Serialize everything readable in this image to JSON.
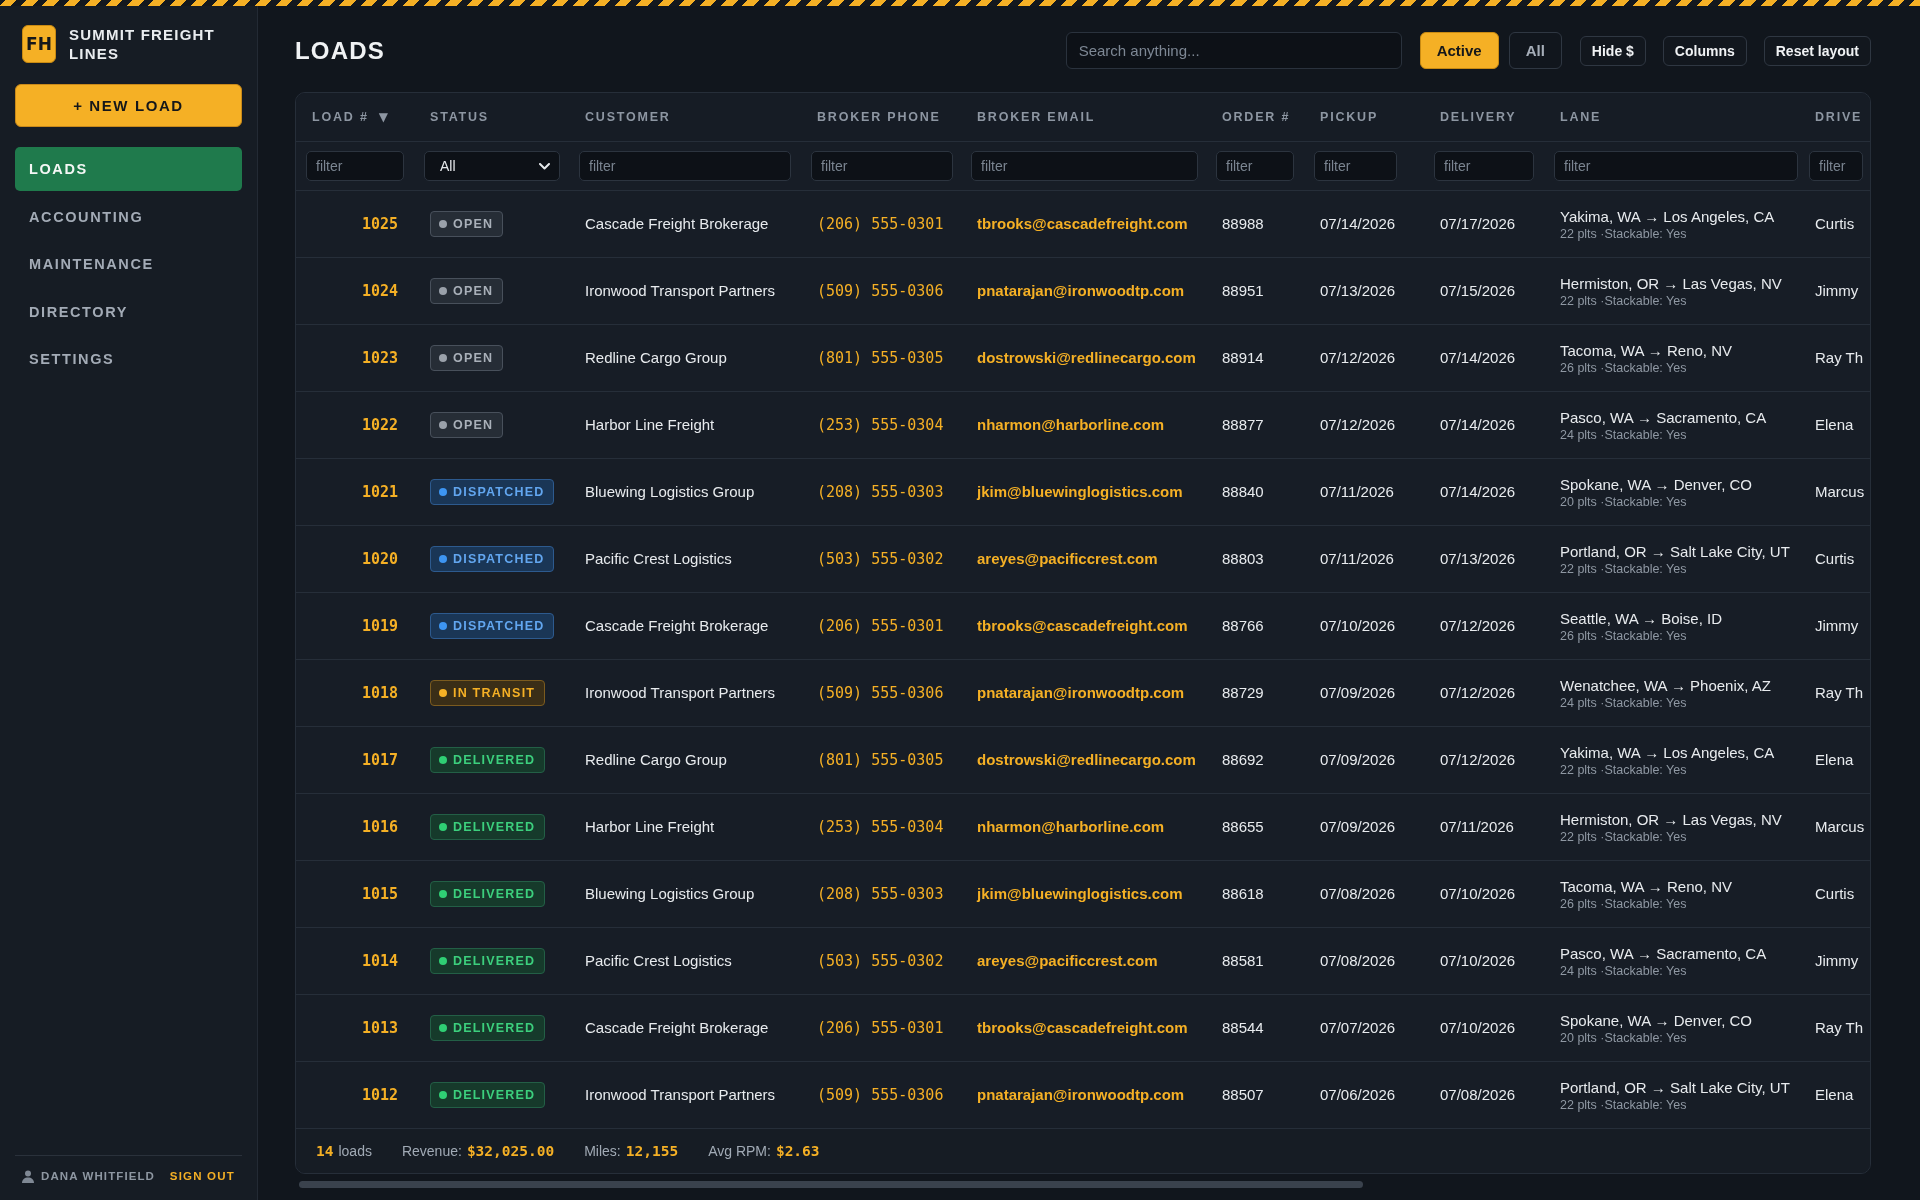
{
  "brand": {
    "badge": "FH",
    "name": "SUMMIT FREIGHT LINES"
  },
  "sidebar": {
    "new_button": "+ NEW LOAD",
    "items": [
      {
        "label": "LOADS",
        "selected": true
      },
      {
        "label": "ACCOUNTING",
        "selected": false
      },
      {
        "label": "MAINTENANCE",
        "selected": false
      },
      {
        "label": "DIRECTORY",
        "selected": false
      },
      {
        "label": "SETTINGS",
        "selected": false
      }
    ],
    "user": {
      "name": "DANA WHITFIELD",
      "sign_out": "SIGN OUT"
    }
  },
  "header": {
    "title": "LOADS",
    "search": {
      "placeholder": "Search anything..."
    },
    "view_filters": [
      {
        "label": "Active",
        "selected": true
      },
      {
        "label": "All",
        "selected": false
      }
    ],
    "buttons": [
      "Hide $",
      "Columns",
      "Reset layout"
    ]
  },
  "table": {
    "columns": [
      {
        "label": "LOAD #",
        "sort": "▼",
        "filter": {
          "kind": "text",
          "placeholder": "filter"
        }
      },
      {
        "label": "STATUS",
        "filter": {
          "kind": "select",
          "value": "All"
        }
      },
      {
        "label": "CUSTOMER",
        "filter": {
          "kind": "text",
          "placeholder": "filter"
        }
      },
      {
        "label": "BROKER PHONE",
        "filter": {
          "kind": "text",
          "placeholder": "filter"
        }
      },
      {
        "label": "BROKER EMAIL",
        "filter": {
          "kind": "text",
          "placeholder": "filter"
        }
      },
      {
        "label": "ORDER #",
        "filter": {
          "kind": "text",
          "placeholder": "filter"
        }
      },
      {
        "label": "PICKUP",
        "filter": {
          "kind": "text",
          "placeholder": "filter"
        }
      },
      {
        "label": "DELIVERY",
        "filter": {
          "kind": "text",
          "placeholder": "filter"
        }
      },
      {
        "label": "LANE",
        "filter": {
          "kind": "text",
          "placeholder": "filter"
        }
      },
      {
        "label": "DRIVE",
        "filter": {
          "kind": "text",
          "placeholder": "filter"
        }
      }
    ],
    "rows": [
      {
        "load": "1025",
        "status": {
          "kind": "open",
          "label": "OPEN"
        },
        "customer": "Cascade Freight Brokerage",
        "broker_phone": "(206) 555-0301",
        "broker_email": "tbrooks@cascadefreight.com",
        "order": "88988",
        "pickup": "07/14/2026",
        "delivery": "07/17/2026",
        "lane": {
          "route": "Yakima, WA → Los Angeles, CA",
          "detail": "22 plts ·Stackable: Yes"
        },
        "column_10": "Curtis"
      },
      {
        "load": "1024",
        "status": {
          "kind": "open",
          "label": "OPEN"
        },
        "customer": "Ironwood Transport Partners",
        "broker_phone": "(509) 555-0306",
        "broker_email": "pnatarajan@ironwoodtp.com",
        "order": "88951",
        "pickup": "07/13/2026",
        "delivery": "07/15/2026",
        "lane": {
          "route": "Hermiston, OR → Las Vegas, NV",
          "detail": "22 plts ·Stackable: Yes"
        },
        "column_10": "Jimmy"
      },
      {
        "load": "1023",
        "status": {
          "kind": "open",
          "label": "OPEN"
        },
        "customer": "Redline Cargo Group",
        "broker_phone": "(801) 555-0305",
        "broker_email": "dostrowski@redlinecargo.com",
        "order": "88914",
        "pickup": "07/12/2026",
        "delivery": "07/14/2026",
        "lane": {
          "route": "Tacoma, WA → Reno, NV",
          "detail": "26 plts ·Stackable: Yes"
        },
        "column_10": "Ray Th"
      },
      {
        "load": "1022",
        "status": {
          "kind": "open",
          "label": "OPEN"
        },
        "customer": "Harbor Line Freight",
        "broker_phone": "(253) 555-0304",
        "broker_email": "nharmon@harborline.com",
        "order": "88877",
        "pickup": "07/12/2026",
        "delivery": "07/14/2026",
        "lane": {
          "route": "Pasco, WA → Sacramento, CA",
          "detail": "24 plts ·Stackable: Yes"
        },
        "column_10": "Elena"
      },
      {
        "load": "1021",
        "status": {
          "kind": "dispatched",
          "label": "DISPATCHED"
        },
        "customer": "Bluewing Logistics Group",
        "broker_phone": "(208) 555-0303",
        "broker_email": "jkim@bluewinglogistics.com",
        "order": "88840",
        "pickup": "07/11/2026",
        "delivery": "07/14/2026",
        "lane": {
          "route": "Spokane, WA → Denver, CO",
          "detail": "20 plts ·Stackable: Yes"
        },
        "column_10": "Marcus"
      },
      {
        "load": "1020",
        "status": {
          "kind": "dispatched",
          "label": "DISPATCHED"
        },
        "customer": "Pacific Crest Logistics",
        "broker_phone": "(503) 555-0302",
        "broker_email": "areyes@pacificcrest.com",
        "order": "88803",
        "pickup": "07/11/2026",
        "delivery": "07/13/2026",
        "lane": {
          "route": "Portland, OR → Salt Lake City, UT",
          "detail": "22 plts ·Stackable: Yes"
        },
        "column_10": "Curtis"
      },
      {
        "load": "1019",
        "status": {
          "kind": "dispatched",
          "label": "DISPATCHED"
        },
        "customer": "Cascade Freight Brokerage",
        "broker_phone": "(206) 555-0301",
        "broker_email": "tbrooks@cascadefreight.com",
        "order": "88766",
        "pickup": "07/10/2026",
        "delivery": "07/12/2026",
        "lane": {
          "route": "Seattle, WA → Boise, ID",
          "detail": "26 plts ·Stackable: Yes"
        },
        "column_10": "Jimmy"
      },
      {
        "load": "1018",
        "status": {
          "kind": "in_transit",
          "label": "IN TRANSIT"
        },
        "customer": "Ironwood Transport Partners",
        "broker_phone": "(509) 555-0306",
        "broker_email": "pnatarajan@ironwoodtp.com",
        "order": "88729",
        "pickup": "07/09/2026",
        "delivery": "07/12/2026",
        "lane": {
          "route": "Wenatchee, WA → Phoenix, AZ",
          "detail": "24 plts ·Stackable: Yes"
        },
        "column_10": "Ray Th"
      },
      {
        "load": "1017",
        "status": {
          "kind": "delivered",
          "label": "DELIVERED"
        },
        "customer": "Redline Cargo Group",
        "broker_phone": "(801) 555-0305",
        "broker_email": "dostrowski@redlinecargo.com",
        "order": "88692",
        "pickup": "07/09/2026",
        "delivery": "07/12/2026",
        "lane": {
          "route": "Yakima, WA → Los Angeles, CA",
          "detail": "22 plts ·Stackable: Yes"
        },
        "column_10": "Elena"
      },
      {
        "load": "1016",
        "status": {
          "kind": "delivered",
          "label": "DELIVERED"
        },
        "customer": "Harbor Line Freight",
        "broker_phone": "(253) 555-0304",
        "broker_email": "nharmon@harborline.com",
        "order": "88655",
        "pickup": "07/09/2026",
        "delivery": "07/11/2026",
        "lane": {
          "route": "Hermiston, OR → Las Vegas, NV",
          "detail": "22 plts ·Stackable: Yes"
        },
        "column_10": "Marcus"
      },
      {
        "load": "1015",
        "status": {
          "kind": "delivered",
          "label": "DELIVERED"
        },
        "customer": "Bluewing Logistics Group",
        "broker_phone": "(208) 555-0303",
        "broker_email": "jkim@bluewinglogistics.com",
        "order": "88618",
        "pickup": "07/08/2026",
        "delivery": "07/10/2026",
        "lane": {
          "route": "Tacoma, WA → Reno, NV",
          "detail": "26 plts ·Stackable: Yes"
        },
        "column_10": "Curtis"
      },
      {
        "load": "1014",
        "status": {
          "kind": "delivered",
          "label": "DELIVERED"
        },
        "customer": "Pacific Crest Logistics",
        "broker_phone": "(503) 555-0302",
        "broker_email": "areyes@pacificcrest.com",
        "order": "88581",
        "pickup": "07/08/2026",
        "delivery": "07/10/2026",
        "lane": {
          "route": "Pasco, WA → Sacramento, CA",
          "detail": "24 plts ·Stackable: Yes"
        },
        "column_10": "Jimmy"
      },
      {
        "load": "1013",
        "status": {
          "kind": "delivered",
          "label": "DELIVERED"
        },
        "customer": "Cascade Freight Brokerage",
        "broker_phone": "(206) 555-0301",
        "broker_email": "tbrooks@cascadefreight.com",
        "order": "88544",
        "pickup": "07/07/2026",
        "delivery": "07/10/2026",
        "lane": {
          "route": "Spokane, WA → Denver, CO",
          "detail": "20 plts ·Stackable: Yes"
        },
        "column_10": "Ray Th"
      },
      {
        "load": "1012",
        "status": {
          "kind": "delivered",
          "label": "DELIVERED"
        },
        "customer": "Ironwood Transport Partners",
        "broker_phone": "(509) 555-0306",
        "broker_email": "pnatarajan@ironwoodtp.com",
        "order": "88507",
        "pickup": "07/06/2026",
        "delivery": "07/08/2026",
        "lane": {
          "route": "Portland, OR → Salt Lake City, UT",
          "detail": "22 plts ·Stackable: Yes"
        },
        "column_10": "Elena"
      }
    ],
    "footer": {
      "count": {
        "value": "14",
        "label": "loads"
      },
      "metrics": [
        {
          "label": "Revenue:",
          "value": "$32,025.00"
        },
        {
          "label": "Miles:",
          "value": "12,155"
        },
        {
          "label": "Avg RPM:",
          "value": "$2.63"
        }
      ]
    }
  }
}
